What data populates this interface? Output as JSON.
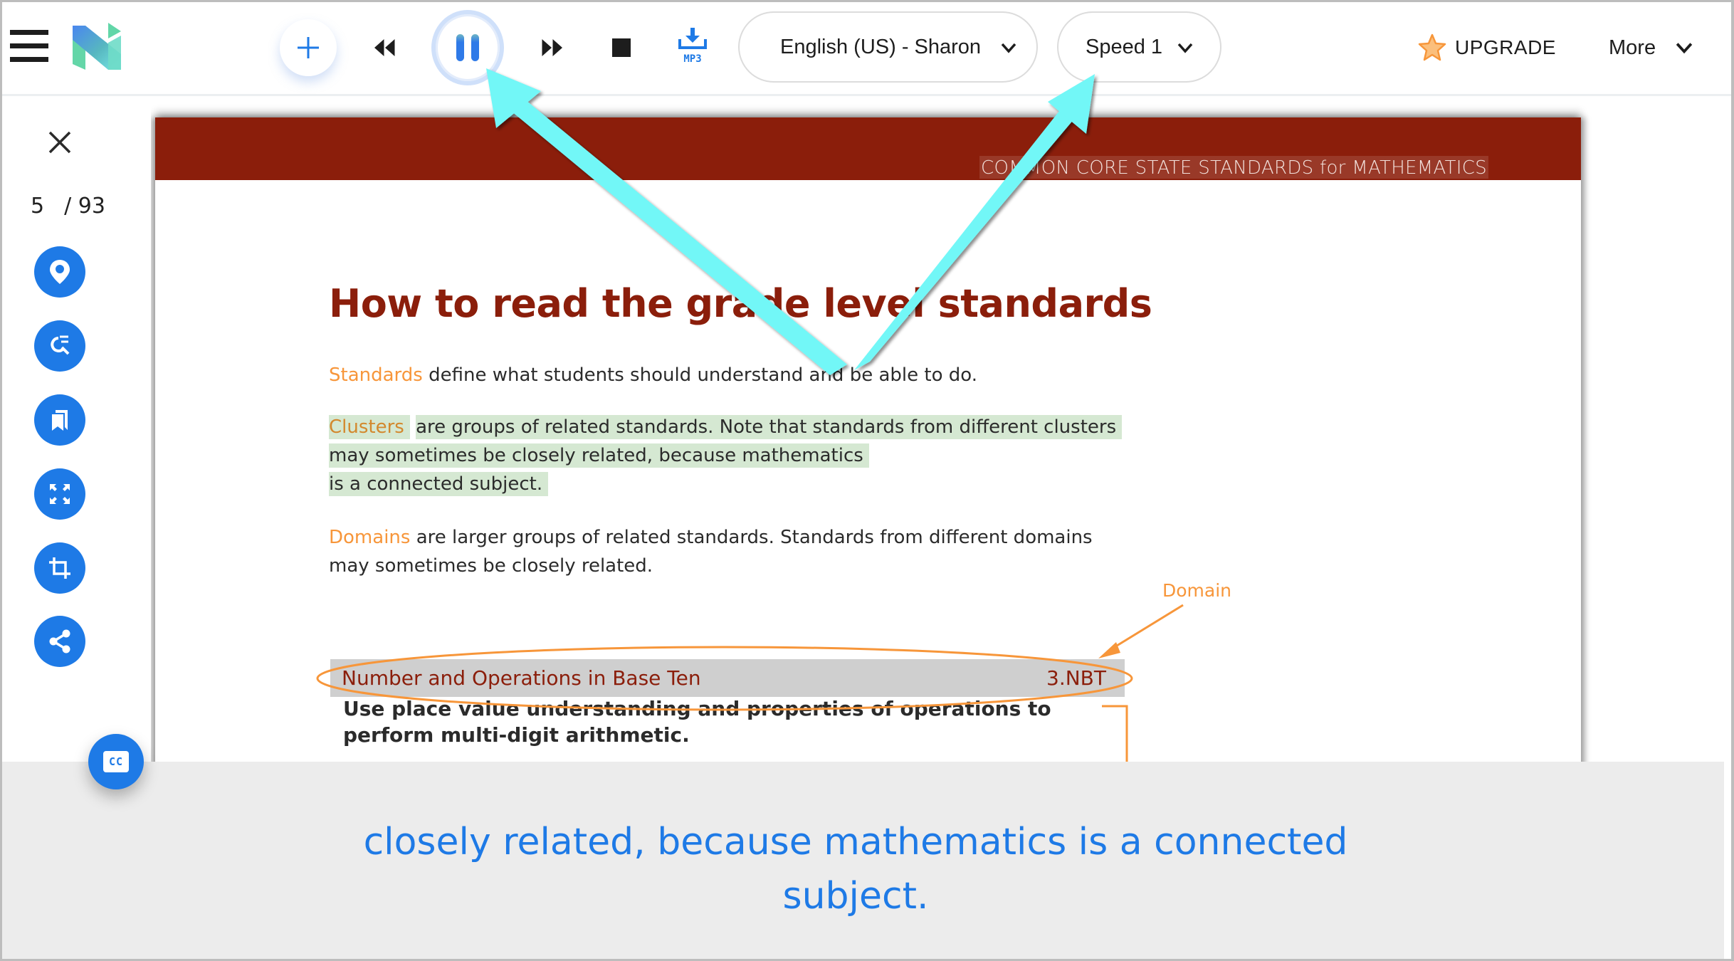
{
  "toolbar": {
    "menu_icon": "hamburger-menu-icon",
    "logo_icon": "naturalreader-logo",
    "add_icon": "plus-icon",
    "rewind_icon": "rewind-icon",
    "pause_icon": "pause-icon",
    "forward_icon": "fast-forward-icon",
    "stop_icon": "stop-icon",
    "mp3_icon": "download-mp3-icon",
    "mp3_label": "MP3",
    "voice_select": "English (US) - Sharon",
    "speed_select": "Speed 1",
    "upgrade_label": "UPGRADE",
    "more_label": "More"
  },
  "sidebar": {
    "close_icon": "close-icon",
    "current_page": "5",
    "total_pages": "/ 93",
    "tools": [
      {
        "name": "location-pin-icon"
      },
      {
        "name": "search-text-icon"
      },
      {
        "name": "bookmarks-icon"
      },
      {
        "name": "fullscreen-icon"
      },
      {
        "name": "crop-icon"
      },
      {
        "name": "share-icon"
      }
    ]
  },
  "document": {
    "header_band": "COMMON CORE STATE STANDARDS for MATHEMATICS",
    "title": "How to read the grade level standards",
    "p1_term": "Standards",
    "p1_rest": " define what students should understand and be able to do.",
    "p2_term": "Clusters",
    "p2_line1_rest": "are groups of related standards. Note that standards from different clusters",
    "p2_line2": "may sometimes be closely related, because mathematics",
    "p2_line3": "is a connected subject.",
    "p3_term": "Domains",
    "p3_line1_rest": " are larger groups of related standards. Standards from different domains",
    "p3_line2": "may sometimes be closely related.",
    "domain_annotation": "Domain",
    "domain_name": "Number and Operations in Base Ten",
    "domain_code": "3.NBT",
    "cluster_line1": "Use place value understanding and properties of operations to",
    "cluster_line2": "perform multi-digit arithmetic."
  },
  "caption": {
    "line1": "closely related, because mathematics is a connected",
    "line2": "subject.",
    "cc_label": "CC"
  },
  "colors": {
    "accent_blue": "#1e7ae6",
    "header_red": "#8b1e0b",
    "term_orange": "#f7963a",
    "highlight_green": "#d5e8d2",
    "annotation_cyan": "#72f7f7"
  }
}
